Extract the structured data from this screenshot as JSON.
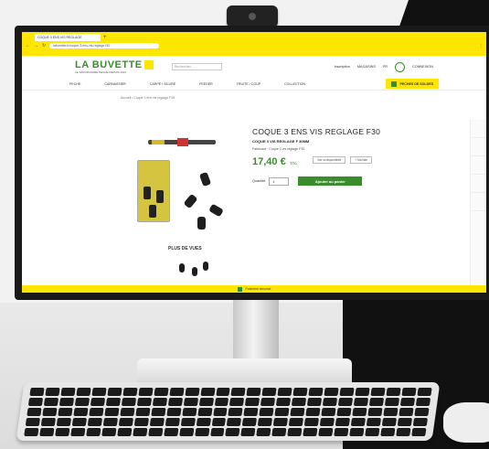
{
  "browser": {
    "tab_title": "COQUE 3 ENS VIS REGLAGE",
    "new_tab": "+",
    "url": "labuvette.fr/coque-3-ens-vis-reglage-f30"
  },
  "site": {
    "logo_name": "LA BUVETTE",
    "logo_tagline": "LE SAVOIR-FAIRE PECHE DEPUIS 1914",
    "search_placeholder": "Rechercher...",
    "header_links": [
      "Inscription",
      "MAGASINS",
      "FR",
      "CONNEXION"
    ],
    "menu": [
      "PECHE",
      "CARNASSIER",
      "CARPE / SILURE",
      "FEEDER",
      "TRUITE / COUP",
      "COLLECTION"
    ],
    "promo_button": "PECHES DE SOLDES",
    "breadcrumb": "Accueil / Coque 3 ens vis reglage F30"
  },
  "product": {
    "title": "COQUE 3 ENS VIS REGLAGE F30",
    "subtitle": "COQUE 3 VIS REGLAGE F 30MM",
    "meta": "Fabricant · Coque 3 vis réglage F30",
    "price": "17,40 €",
    "price_suffix": "TTC",
    "quantity_label": "Quantité",
    "quantity_value": "1",
    "add_to_cart": "Ajouter au panier",
    "stock_label": "Voir la disponibilité",
    "wish_label": "+ Ma liste",
    "more_views": "PLUS DE VUES"
  },
  "footer": {
    "text": "Paiement sécurisé"
  },
  "colors": {
    "brand_yellow": "#ffe600",
    "brand_green": "#3a8d2b"
  }
}
